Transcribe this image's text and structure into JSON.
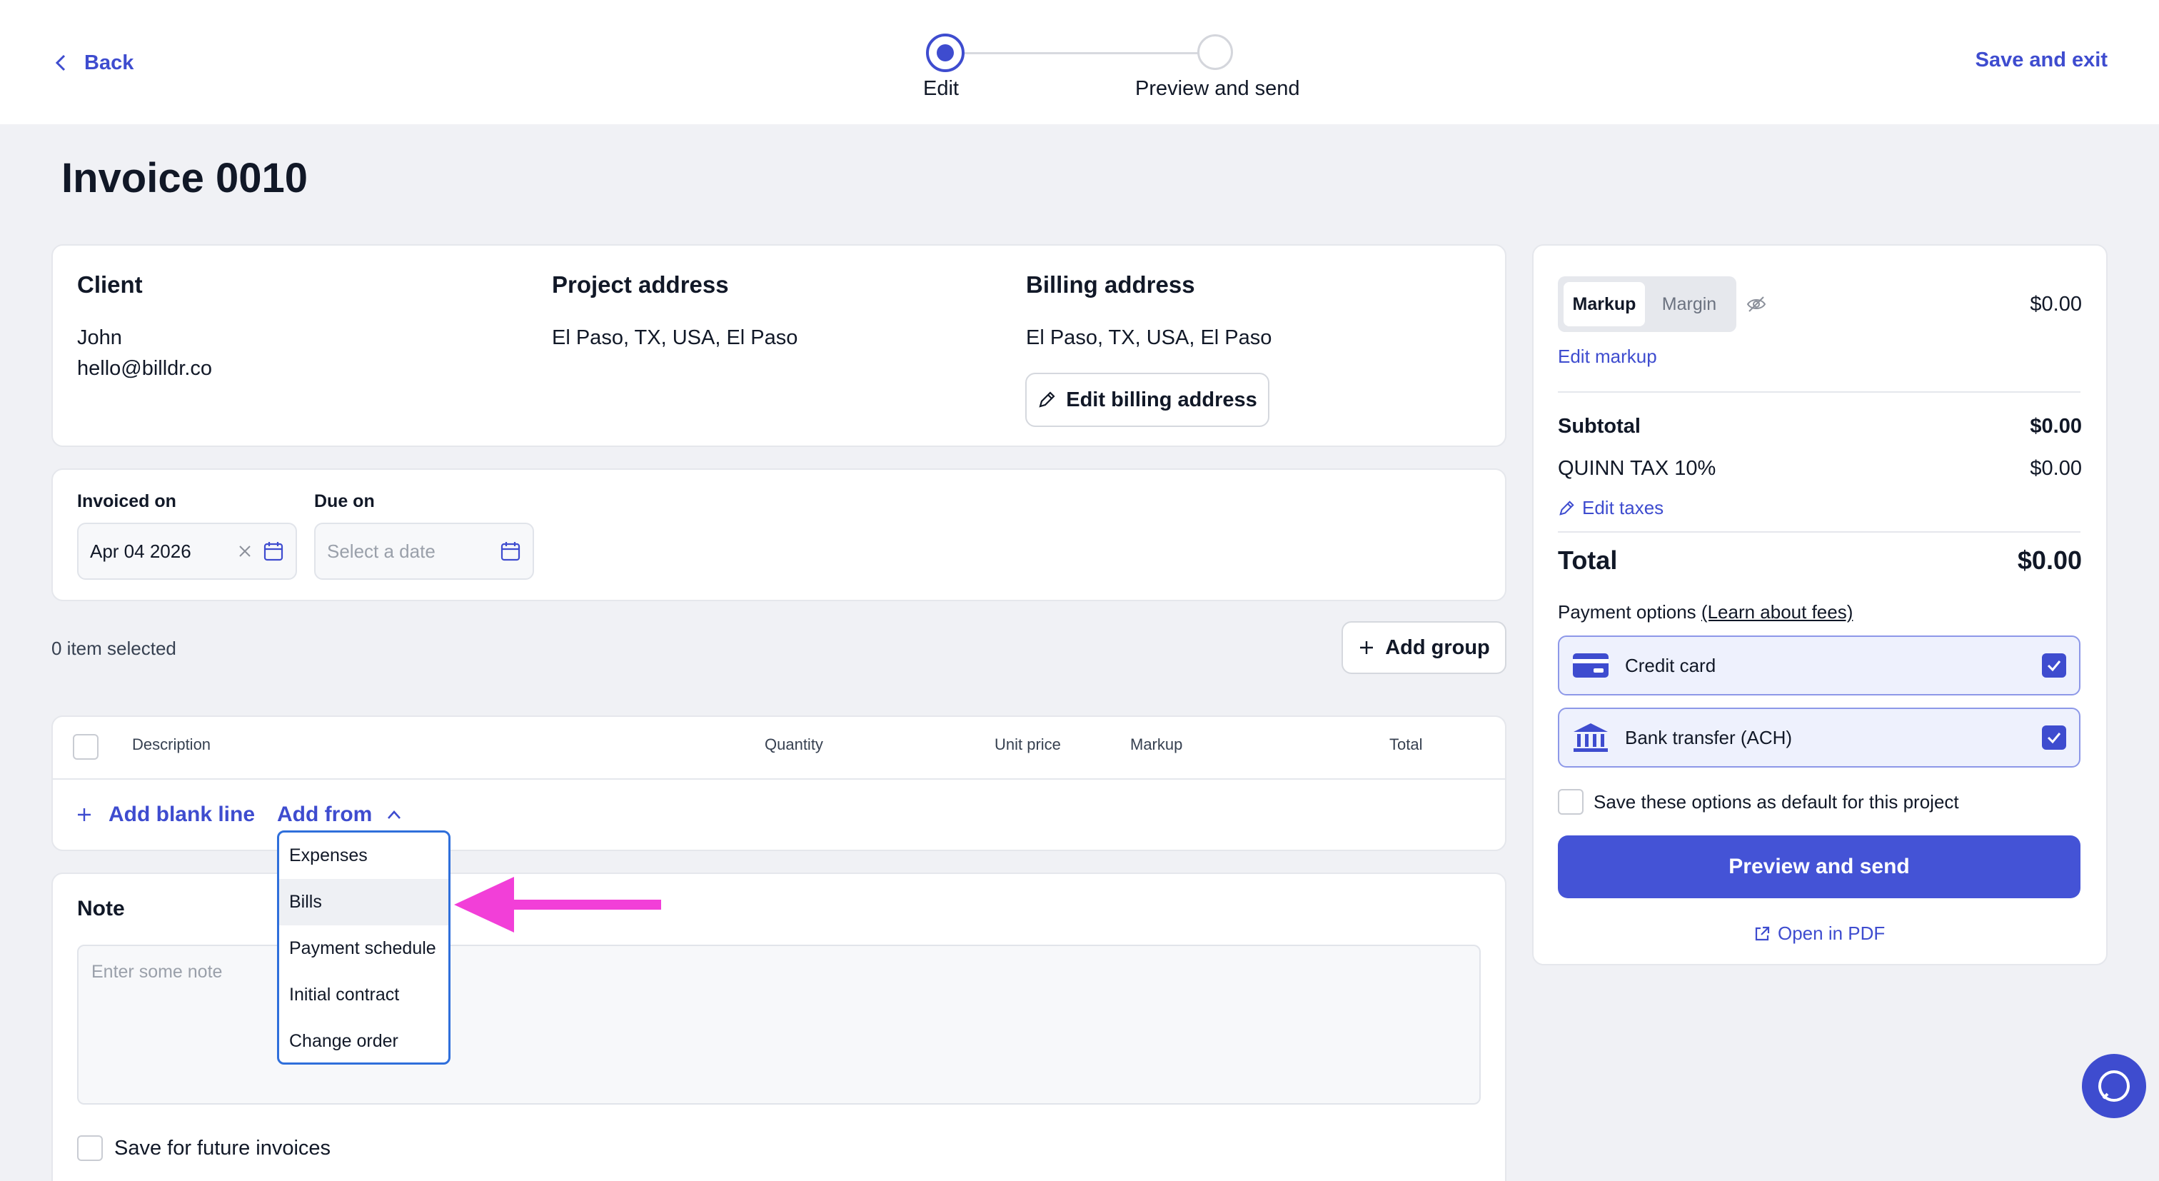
{
  "header": {
    "back_label": "Back",
    "save_exit_label": "Save and exit",
    "steps": [
      {
        "label": "Edit",
        "state": "active"
      },
      {
        "label": "Preview and send",
        "state": "inactive"
      }
    ]
  },
  "page_title": "Invoice 0010",
  "addresses": {
    "client_title": "Client",
    "client_name": "John",
    "client_email": "hello@billdr.co",
    "project_title": "Project address",
    "project_address": "El Paso, TX, USA, El Paso",
    "billing_title": "Billing address",
    "billing_address": "El Paso, TX, USA, El Paso",
    "edit_billing_label": "Edit billing address"
  },
  "dates": {
    "invoiced_label": "Invoiced on",
    "invoiced_value": "Apr 04 2026",
    "due_label": "Due on",
    "due_placeholder": "Select a date"
  },
  "items": {
    "selected_text": "0 item selected",
    "add_group_label": "Add group",
    "columns": [
      "Description",
      "Quantity",
      "Unit price",
      "Markup",
      "Total"
    ],
    "add_blank_line_label": "Add blank line",
    "add_from_label": "Add from",
    "add_from_options": [
      "Expenses",
      "Bills",
      "Payment schedule",
      "Initial contract",
      "Change order"
    ],
    "highlighted_option": "Bills"
  },
  "note": {
    "title": "Note",
    "placeholder": "Enter some note",
    "save_future_label": "Save for future invoices"
  },
  "summary": {
    "markup_tab": "Markup",
    "margin_tab": "Margin",
    "markup_value": "$0.00",
    "edit_markup_label": "Edit markup",
    "subtotal_label": "Subtotal",
    "subtotal_value": "$0.00",
    "tax_label": "QUINN TAX 10%",
    "tax_value": "$0.00",
    "edit_taxes_label": "Edit taxes",
    "total_label": "Total",
    "total_value": "$0.00",
    "payment_options_label": "Payment options",
    "learn_fees_label": "(Learn about fees)",
    "payment_methods": [
      {
        "label": "Credit card",
        "icon": "credit-card-icon",
        "checked": true
      },
      {
        "label": "Bank transfer (ACH)",
        "icon": "bank-icon",
        "checked": true
      }
    ],
    "save_default_label": "Save these options as default for this project",
    "preview_send_label": "Preview and send",
    "open_pdf_label": "Open in PDF"
  },
  "colors": {
    "accent": "#3e4ccf",
    "annotation_arrow": "#f23fd8"
  }
}
